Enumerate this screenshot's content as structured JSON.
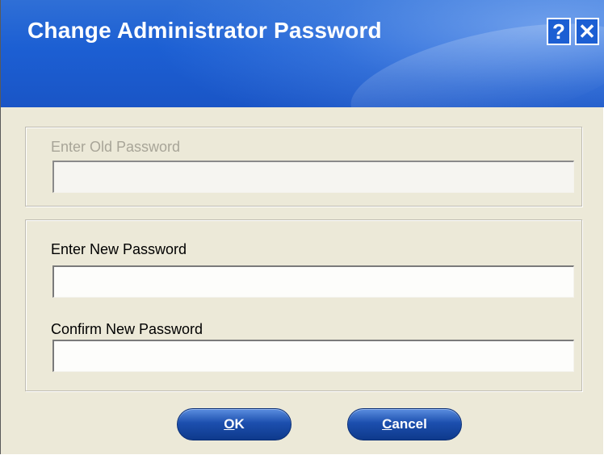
{
  "dialog": {
    "title": "Change Administrator Password",
    "help_label": "?",
    "close_label": "✕"
  },
  "old_password": {
    "label": "Enter Old Password",
    "value": ""
  },
  "new_password": {
    "label": "Enter New Password",
    "value": ""
  },
  "confirm_password": {
    "label": "Confirm New Password",
    "value": ""
  },
  "buttons": {
    "ok_mnemonic": "O",
    "ok_rest": "K",
    "cancel_mnemonic": "C",
    "cancel_rest": "ancel"
  },
  "colors": {
    "titlebar": "#1c5fd3",
    "dialog_bg": "#ece9d8",
    "button": "#1c4fae",
    "disabled_text": "#a8a598"
  }
}
